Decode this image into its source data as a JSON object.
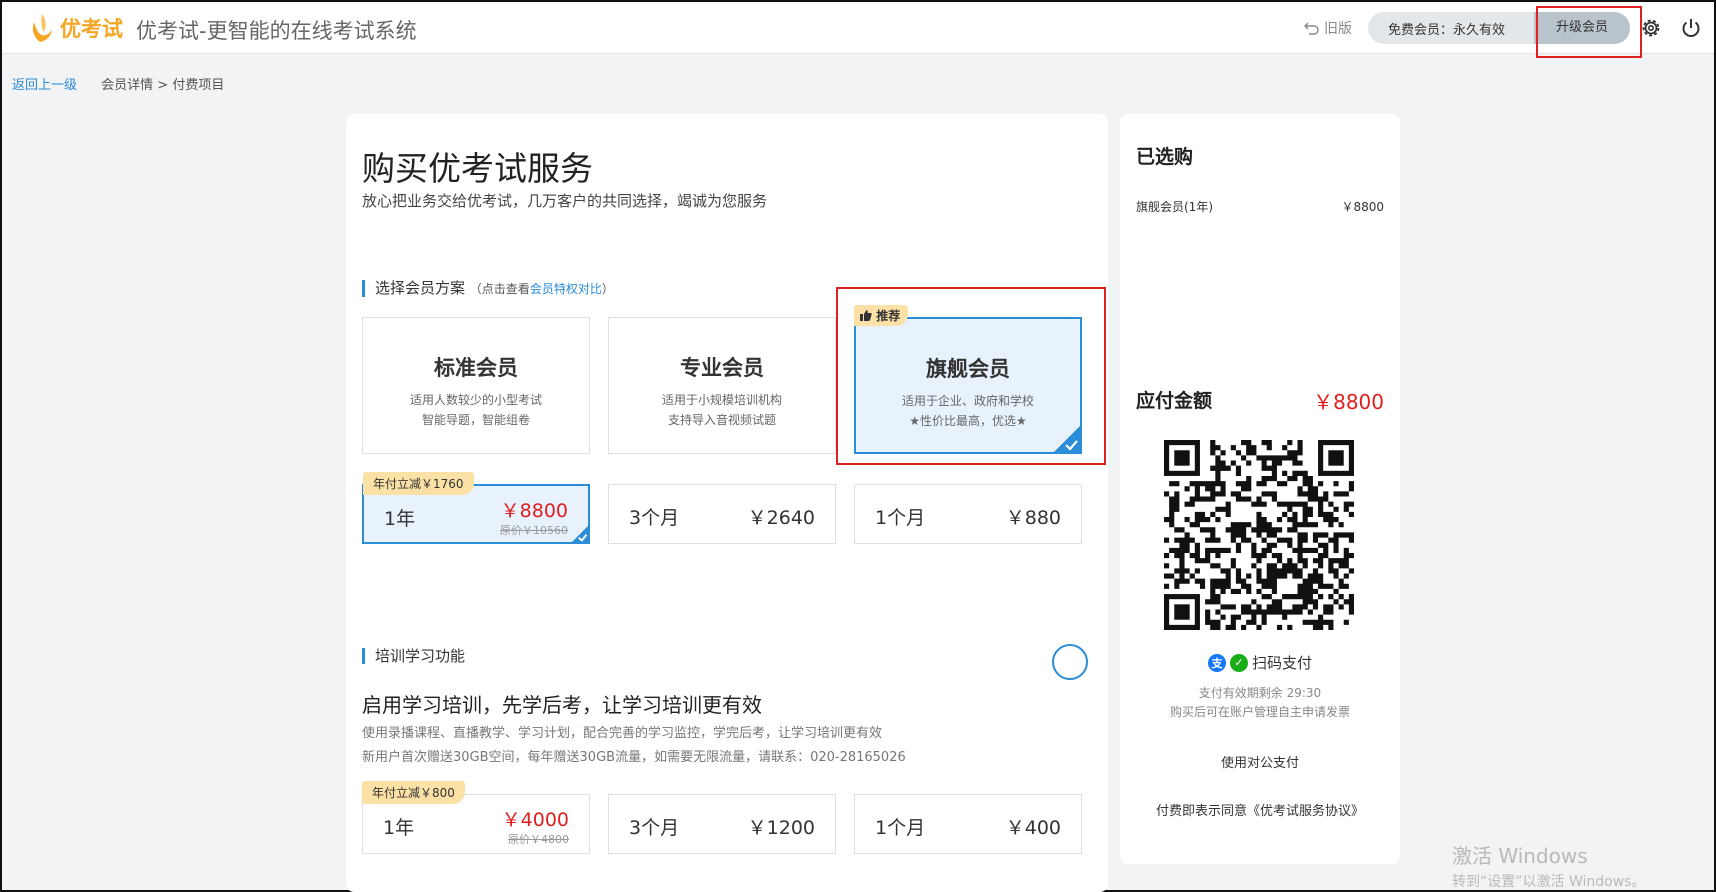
{
  "header": {
    "logo_text": "优考试",
    "app_title": "优考试-更智能的在线考试系统",
    "old_version": "旧版",
    "member_status": "免费会员：永久有效",
    "upgrade_label": "升级会员"
  },
  "breadcrumb": {
    "back": "返回上一级",
    "path": "会员详情 > 付费项目"
  },
  "main": {
    "title": "购买优考试服务",
    "subtitle": "放心把业务交给优考试，几万客户的共同选择，竭诚为您服务",
    "plan_section": {
      "label": "选择会员方案",
      "hint_prefix": "（点击查看",
      "hint_link": "会员特权对比",
      "hint_suffix": "）"
    },
    "plans": [
      {
        "name": "标准会员",
        "desc1": "适用人数较少的小型考试",
        "desc2": "智能导题，智能组卷"
      },
      {
        "name": "专业会员",
        "desc1": "适用于小规模培训机构",
        "desc2": "支持导入音视频试题"
      },
      {
        "name": "旗舰会员",
        "desc1": "适用于企业、政府和学校",
        "desc2": "★性价比最高，优选★",
        "tag": "推荐"
      }
    ],
    "membership_prices": [
      {
        "duration": "1年",
        "price": "￥8800",
        "original": "原价￥10560",
        "badge": "年付立减￥1760"
      },
      {
        "duration": "3个月",
        "price": "￥2640"
      },
      {
        "duration": "1个月",
        "price": "￥880"
      }
    ],
    "training": {
      "label": "培训学习功能",
      "title": "启用学习培训，先学后考，让学习培训更有效",
      "desc1": "使用录播课程、直播教学、学习计划，配合完善的学习监控，学完后考，让学习培训更有效",
      "desc2": "新用户首次赠送30GB空间，每年赠送30GB流量，如需要无限流量，请联系：020-28165026",
      "prices": [
        {
          "duration": "1年",
          "price": "￥4000",
          "original": "原价￥4800",
          "badge": "年付立减￥800"
        },
        {
          "duration": "3个月",
          "price": "￥1200"
        },
        {
          "duration": "1个月",
          "price": "￥400"
        }
      ]
    }
  },
  "side": {
    "title": "已选购",
    "item_name": "旗舰会员(1年)",
    "item_price": "￥8800",
    "pay_label": "应付金额",
    "pay_amount": "￥8800",
    "scan_label": "扫码支付",
    "expire_note": "支付有效期剩余 29:30",
    "invoice_note": "购买后可在账户管理自主申请发票",
    "corporate_pay": "使用对公支付",
    "agreement": "付费即表示同意《优考试服务协议》"
  },
  "watermark": {
    "line1": "激活 Windows",
    "line2": "转到“设置”以激活 Windows。"
  },
  "colors": {
    "accent": "#2b8cd8",
    "price_red": "#e02020",
    "badge_bg": "#fbe1a6",
    "logo_orange": "#f5a623"
  }
}
